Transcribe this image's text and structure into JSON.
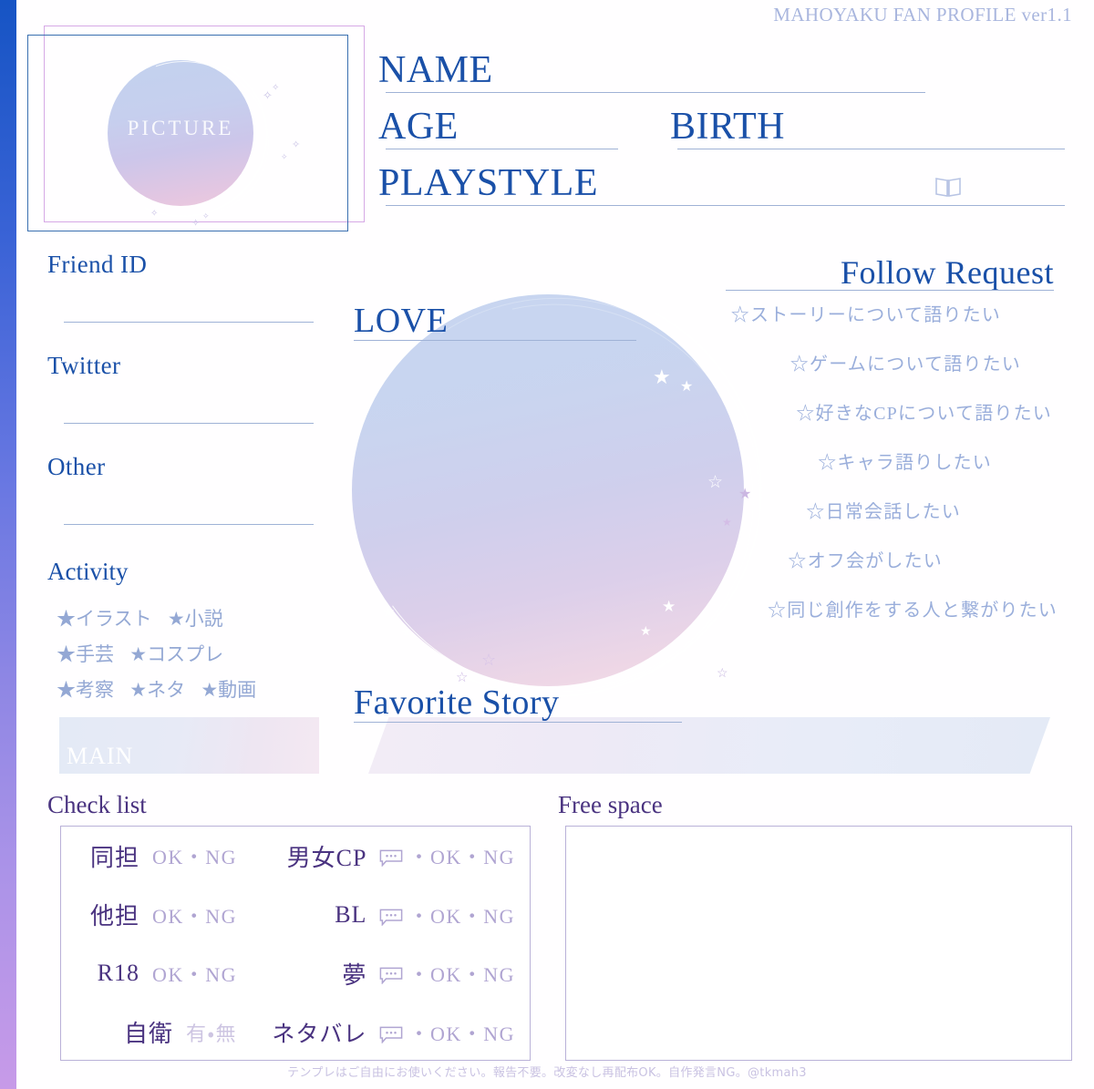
{
  "header": {
    "title": "MAHOYAKU FAN PROFILE ver1.1"
  },
  "picture": {
    "placeholder_label": "PICTURE"
  },
  "fields": [
    {
      "label": "NAME"
    },
    {
      "label": "AGE"
    },
    {
      "label": "BIRTH"
    },
    {
      "label": "PLAYSTYLE"
    }
  ],
  "contact": {
    "items": [
      {
        "label": "Friend ID"
      },
      {
        "label": "Twitter"
      },
      {
        "label": "Other"
      }
    ]
  },
  "activity": {
    "title": "Activity",
    "tags": [
      [
        "★イラスト",
        "★小説"
      ],
      [
        "★手芸",
        "★コスプレ"
      ],
      [
        "★考察",
        "★ネタ",
        "★動画"
      ]
    ],
    "main_band_label": "MAIN"
  },
  "love": {
    "label": "LOVE"
  },
  "favorite_story": {
    "label": "Favorite Story"
  },
  "follow_request": {
    "title": "Follow Request",
    "items": [
      "☆ストーリーについて語りたい",
      "☆ゲームについて語りたい",
      "☆好きなCPについて語りたい",
      "☆キャラ語りしたい",
      "☆日常会話したい",
      "☆オフ会がしたい",
      "☆同じ創作をする人と繋がりたい"
    ]
  },
  "check_list": {
    "title": "Check list",
    "rows": [
      {
        "left_key": "同担",
        "left_val": "OK・NG",
        "right_key": "男女CP",
        "right_val": "・OK・NG",
        "right_has_bubble": true
      },
      {
        "left_key": "他担",
        "left_val": "OK・NG",
        "right_key": "BL",
        "right_val": "・OK・NG",
        "right_has_bubble": true
      },
      {
        "left_key": "R18",
        "left_val": "OK・NG",
        "right_key": "夢",
        "right_val": "・OK・NG",
        "right_has_bubble": true
      },
      {
        "left_key": "自衛",
        "left_val": "有・無",
        "right_key": "ネタバレ",
        "right_val": "・OK・NG",
        "right_has_bubble": true
      }
    ]
  },
  "free_space": {
    "title": "Free space"
  },
  "footer": {
    "text": "テンプレはご自由にお使いください。報告不要。改変なし再配布OK。自作発言NG。@tkmah3"
  },
  "colors": {
    "deep_blue": "#1a50a8",
    "muted_blue": "#9aaedb",
    "header_blue": "#a9b6de",
    "rule_blue": "#9fb2d6",
    "deep_purple": "#4a3380",
    "muted_purple": "#b0a5d2",
    "frame_pink": "#d6a9e6",
    "frame_blue": "#3a6fb0"
  }
}
